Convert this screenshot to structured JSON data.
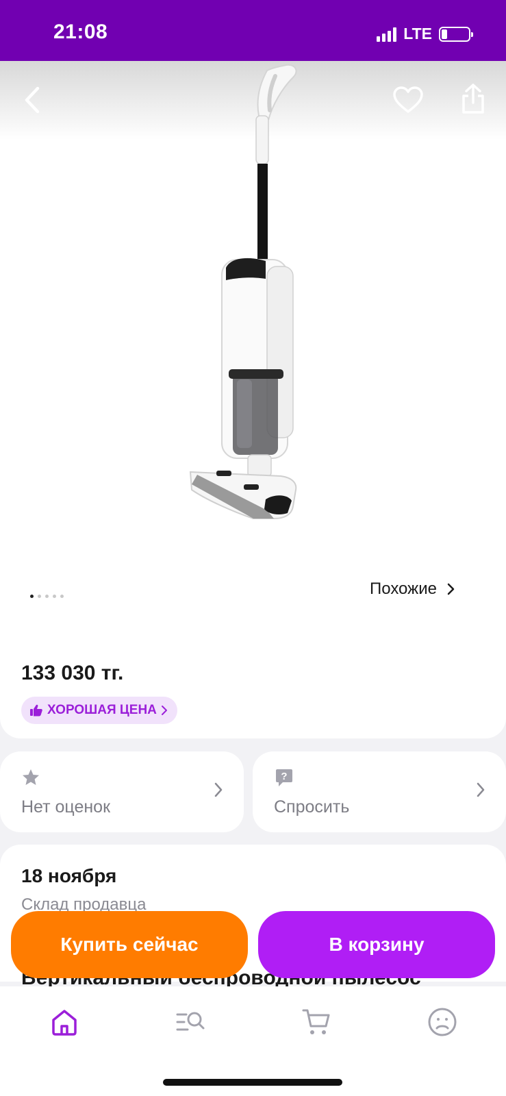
{
  "status_bar": {
    "time": "21:08",
    "network": "LTE",
    "battery_level": 0.2
  },
  "gallery": {
    "image_count": 5,
    "active_index": 0,
    "similar_label": "Похожие"
  },
  "price": {
    "value": "133 030 тг.",
    "badge": "ХОРОШАЯ ЦЕНА"
  },
  "rating": {
    "label": "Нет оценок"
  },
  "question": {
    "label": "Спросить"
  },
  "delivery": {
    "date": "18 ноября",
    "source": "Склад продавца"
  },
  "product": {
    "title": "Вертикальный беспроводной пылесос"
  },
  "actions": {
    "buy_now": "Купить сейчас",
    "add_to_cart": "В корзину"
  },
  "colors": {
    "brand_purple": "#7100b1",
    "accent_orange": "#ff7c00",
    "accent_violet": "#b01ef5"
  },
  "tab_bar": {
    "items": [
      "home-icon",
      "catalog-search-icon",
      "cart-icon",
      "profile-icon"
    ],
    "active": "home"
  }
}
